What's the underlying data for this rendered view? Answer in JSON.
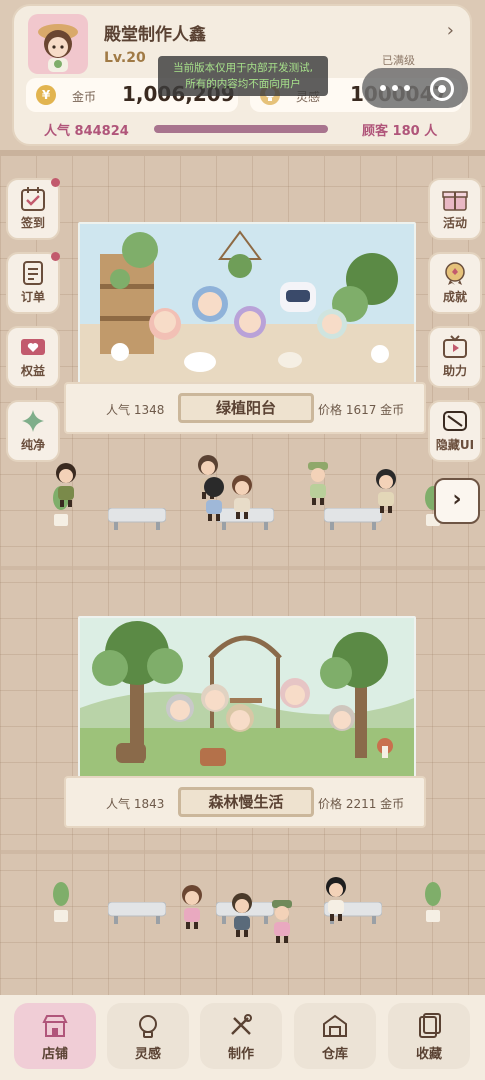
{
  "profile": {
    "shop_name": "殿堂制作人鑫",
    "level": "Lv.20",
    "level_status": "已满级"
  },
  "currency": {
    "gold_label": "金币",
    "gold_icon_glyph": "¥",
    "gold_value": "1,006,209",
    "inspiration_label": "灵感",
    "inspiration_value": "1000047"
  },
  "notice": {
    "line1": "当前版本仅用于内部开发测试,",
    "line2": "所有的内容均不面向用户"
  },
  "stats": {
    "popularity": "人气 844824",
    "customers": "顾客 180 人",
    "progress": 1.0
  },
  "left_buttons": [
    {
      "label": "签到",
      "icon": "calendar-check-icon",
      "badge": true
    },
    {
      "label": "订单",
      "icon": "order-list-icon",
      "badge": true
    },
    {
      "label": "权益",
      "icon": "heart-ticket-icon",
      "badge": false
    },
    {
      "label": "纯净",
      "icon": "sparkle-icon",
      "badge": false
    }
  ],
  "right_buttons": [
    {
      "label": "活动",
      "icon": "gift-icon"
    },
    {
      "label": "成就",
      "icon": "medal-icon"
    },
    {
      "label": "助力",
      "icon": "tv-play-icon"
    },
    {
      "label": "隐藏UI",
      "icon": "hide-ui-icon"
    }
  ],
  "arrow_glyph": "›",
  "cases": [
    {
      "popularity": "人气 1348",
      "name": "绿植阳台",
      "price": "价格 1617 金币",
      "theme_colors": [
        "#cfe6ef",
        "#e8d9c1",
        "#7fae6a"
      ]
    },
    {
      "popularity": "人气 1843",
      "name": "森林慢生活",
      "price": "价格 2211 金币",
      "theme_colors": [
        "#dceee4",
        "#9dc27a",
        "#5b8a45"
      ]
    }
  ],
  "tabs": [
    {
      "label": "店铺",
      "icon": "shop-icon",
      "active": true
    },
    {
      "label": "灵感",
      "icon": "lightbulb-icon",
      "active": false
    },
    {
      "label": "制作",
      "icon": "tools-icon",
      "active": false
    },
    {
      "label": "仓库",
      "icon": "warehouse-icon",
      "active": false
    },
    {
      "label": "收藏",
      "icon": "collection-icon",
      "active": false
    }
  ],
  "colors": {
    "accent": "#b0557a",
    "panel": "#f4ece0",
    "active_tab": "#f0cdd6",
    "badge": "#c25a6d"
  }
}
